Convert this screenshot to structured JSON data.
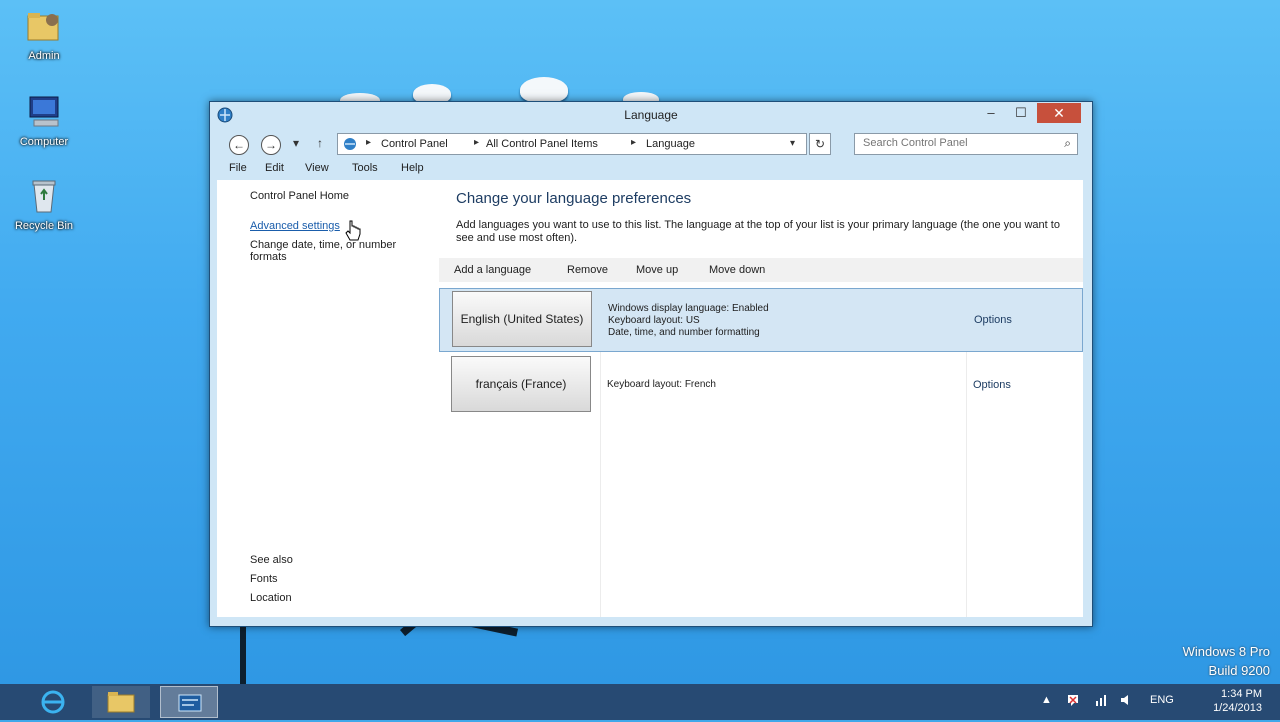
{
  "desktop": {
    "icons": [
      {
        "label": "Admin"
      },
      {
        "label": "Computer"
      },
      {
        "label": "Recycle Bin"
      }
    ],
    "watermark": {
      "line1": "Windows 8 Pro",
      "line2": "Build 9200"
    }
  },
  "window": {
    "title": "Language",
    "controls": {
      "minimize": "–",
      "maximize": "☐",
      "close": "✕"
    }
  },
  "nav": {
    "back": "←",
    "forward": "→",
    "recent": "▾",
    "up": "↑",
    "breadcrumb": [
      "Control Panel",
      "All Control Panel Items",
      "Language"
    ],
    "separator": "▸",
    "dropdown": "▾",
    "refresh": "↻",
    "search_placeholder": "Search Control Panel",
    "search_icon": "⌕"
  },
  "menu": {
    "file": "File",
    "edit": "Edit",
    "view": "View",
    "tools": "Tools",
    "help": "Help"
  },
  "left_pane": {
    "home": "Control Panel Home",
    "advanced": "Advanced settings",
    "date_formats": "Change date, time, or number formats",
    "see_also": "See also",
    "fonts": "Fonts",
    "location": "Location"
  },
  "main": {
    "title": "Change your language preferences",
    "description": "Add languages you want to use to this list. The language at the top of your list is your primary language (the one you want to see and use most often).",
    "toolbar": {
      "add": "Add a language",
      "remove": "Remove",
      "move_up": "Move up",
      "move_down": "Move down"
    },
    "languages": [
      {
        "name": "English (United States)",
        "details": [
          "Windows display language: Enabled",
          "Keyboard layout: US",
          "Date, time, and number formatting"
        ],
        "options": "Options"
      },
      {
        "name": "français (France)",
        "details": [
          "Keyboard layout: French"
        ],
        "options": "Options"
      }
    ]
  },
  "taskbar": {
    "tray": {
      "show_hidden": "▲",
      "language": "ENG"
    },
    "time": "1:34 PM",
    "date": "1/24/2013"
  },
  "colors": {
    "desktop_sky": "#41aaf0",
    "window_frame": "#cfe6f6",
    "selected_row": "#d4e6f4",
    "close_button": "#c7503c",
    "taskbar": "#274a73"
  }
}
